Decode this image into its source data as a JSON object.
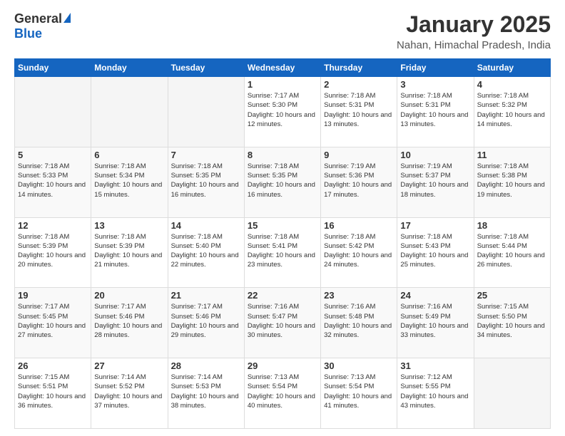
{
  "logo": {
    "general": "General",
    "blue": "Blue"
  },
  "title": "January 2025",
  "subtitle": "Nahan, Himachal Pradesh, India",
  "days_of_week": [
    "Sunday",
    "Monday",
    "Tuesday",
    "Wednesday",
    "Thursday",
    "Friday",
    "Saturday"
  ],
  "weeks": [
    [
      {
        "day": "",
        "sunrise": "",
        "sunset": "",
        "daylight": ""
      },
      {
        "day": "",
        "sunrise": "",
        "sunset": "",
        "daylight": ""
      },
      {
        "day": "",
        "sunrise": "",
        "sunset": "",
        "daylight": ""
      },
      {
        "day": "1",
        "sunrise": "Sunrise: 7:17 AM",
        "sunset": "Sunset: 5:30 PM",
        "daylight": "Daylight: 10 hours and 12 minutes."
      },
      {
        "day": "2",
        "sunrise": "Sunrise: 7:18 AM",
        "sunset": "Sunset: 5:31 PM",
        "daylight": "Daylight: 10 hours and 13 minutes."
      },
      {
        "day": "3",
        "sunrise": "Sunrise: 7:18 AM",
        "sunset": "Sunset: 5:31 PM",
        "daylight": "Daylight: 10 hours and 13 minutes."
      },
      {
        "day": "4",
        "sunrise": "Sunrise: 7:18 AM",
        "sunset": "Sunset: 5:32 PM",
        "daylight": "Daylight: 10 hours and 14 minutes."
      }
    ],
    [
      {
        "day": "5",
        "sunrise": "Sunrise: 7:18 AM",
        "sunset": "Sunset: 5:33 PM",
        "daylight": "Daylight: 10 hours and 14 minutes."
      },
      {
        "day": "6",
        "sunrise": "Sunrise: 7:18 AM",
        "sunset": "Sunset: 5:34 PM",
        "daylight": "Daylight: 10 hours and 15 minutes."
      },
      {
        "day": "7",
        "sunrise": "Sunrise: 7:18 AM",
        "sunset": "Sunset: 5:35 PM",
        "daylight": "Daylight: 10 hours and 16 minutes."
      },
      {
        "day": "8",
        "sunrise": "Sunrise: 7:18 AM",
        "sunset": "Sunset: 5:35 PM",
        "daylight": "Daylight: 10 hours and 16 minutes."
      },
      {
        "day": "9",
        "sunrise": "Sunrise: 7:19 AM",
        "sunset": "Sunset: 5:36 PM",
        "daylight": "Daylight: 10 hours and 17 minutes."
      },
      {
        "day": "10",
        "sunrise": "Sunrise: 7:19 AM",
        "sunset": "Sunset: 5:37 PM",
        "daylight": "Daylight: 10 hours and 18 minutes."
      },
      {
        "day": "11",
        "sunrise": "Sunrise: 7:18 AM",
        "sunset": "Sunset: 5:38 PM",
        "daylight": "Daylight: 10 hours and 19 minutes."
      }
    ],
    [
      {
        "day": "12",
        "sunrise": "Sunrise: 7:18 AM",
        "sunset": "Sunset: 5:39 PM",
        "daylight": "Daylight: 10 hours and 20 minutes."
      },
      {
        "day": "13",
        "sunrise": "Sunrise: 7:18 AM",
        "sunset": "Sunset: 5:39 PM",
        "daylight": "Daylight: 10 hours and 21 minutes."
      },
      {
        "day": "14",
        "sunrise": "Sunrise: 7:18 AM",
        "sunset": "Sunset: 5:40 PM",
        "daylight": "Daylight: 10 hours and 22 minutes."
      },
      {
        "day": "15",
        "sunrise": "Sunrise: 7:18 AM",
        "sunset": "Sunset: 5:41 PM",
        "daylight": "Daylight: 10 hours and 23 minutes."
      },
      {
        "day": "16",
        "sunrise": "Sunrise: 7:18 AM",
        "sunset": "Sunset: 5:42 PM",
        "daylight": "Daylight: 10 hours and 24 minutes."
      },
      {
        "day": "17",
        "sunrise": "Sunrise: 7:18 AM",
        "sunset": "Sunset: 5:43 PM",
        "daylight": "Daylight: 10 hours and 25 minutes."
      },
      {
        "day": "18",
        "sunrise": "Sunrise: 7:18 AM",
        "sunset": "Sunset: 5:44 PM",
        "daylight": "Daylight: 10 hours and 26 minutes."
      }
    ],
    [
      {
        "day": "19",
        "sunrise": "Sunrise: 7:17 AM",
        "sunset": "Sunset: 5:45 PM",
        "daylight": "Daylight: 10 hours and 27 minutes."
      },
      {
        "day": "20",
        "sunrise": "Sunrise: 7:17 AM",
        "sunset": "Sunset: 5:46 PM",
        "daylight": "Daylight: 10 hours and 28 minutes."
      },
      {
        "day": "21",
        "sunrise": "Sunrise: 7:17 AM",
        "sunset": "Sunset: 5:46 PM",
        "daylight": "Daylight: 10 hours and 29 minutes."
      },
      {
        "day": "22",
        "sunrise": "Sunrise: 7:16 AM",
        "sunset": "Sunset: 5:47 PM",
        "daylight": "Daylight: 10 hours and 30 minutes."
      },
      {
        "day": "23",
        "sunrise": "Sunrise: 7:16 AM",
        "sunset": "Sunset: 5:48 PM",
        "daylight": "Daylight: 10 hours and 32 minutes."
      },
      {
        "day": "24",
        "sunrise": "Sunrise: 7:16 AM",
        "sunset": "Sunset: 5:49 PM",
        "daylight": "Daylight: 10 hours and 33 minutes."
      },
      {
        "day": "25",
        "sunrise": "Sunrise: 7:15 AM",
        "sunset": "Sunset: 5:50 PM",
        "daylight": "Daylight: 10 hours and 34 minutes."
      }
    ],
    [
      {
        "day": "26",
        "sunrise": "Sunrise: 7:15 AM",
        "sunset": "Sunset: 5:51 PM",
        "daylight": "Daylight: 10 hours and 36 minutes."
      },
      {
        "day": "27",
        "sunrise": "Sunrise: 7:14 AM",
        "sunset": "Sunset: 5:52 PM",
        "daylight": "Daylight: 10 hours and 37 minutes."
      },
      {
        "day": "28",
        "sunrise": "Sunrise: 7:14 AM",
        "sunset": "Sunset: 5:53 PM",
        "daylight": "Daylight: 10 hours and 38 minutes."
      },
      {
        "day": "29",
        "sunrise": "Sunrise: 7:13 AM",
        "sunset": "Sunset: 5:54 PM",
        "daylight": "Daylight: 10 hours and 40 minutes."
      },
      {
        "day": "30",
        "sunrise": "Sunrise: 7:13 AM",
        "sunset": "Sunset: 5:54 PM",
        "daylight": "Daylight: 10 hours and 41 minutes."
      },
      {
        "day": "31",
        "sunrise": "Sunrise: 7:12 AM",
        "sunset": "Sunset: 5:55 PM",
        "daylight": "Daylight: 10 hours and 43 minutes."
      },
      {
        "day": "",
        "sunrise": "",
        "sunset": "",
        "daylight": ""
      }
    ]
  ]
}
